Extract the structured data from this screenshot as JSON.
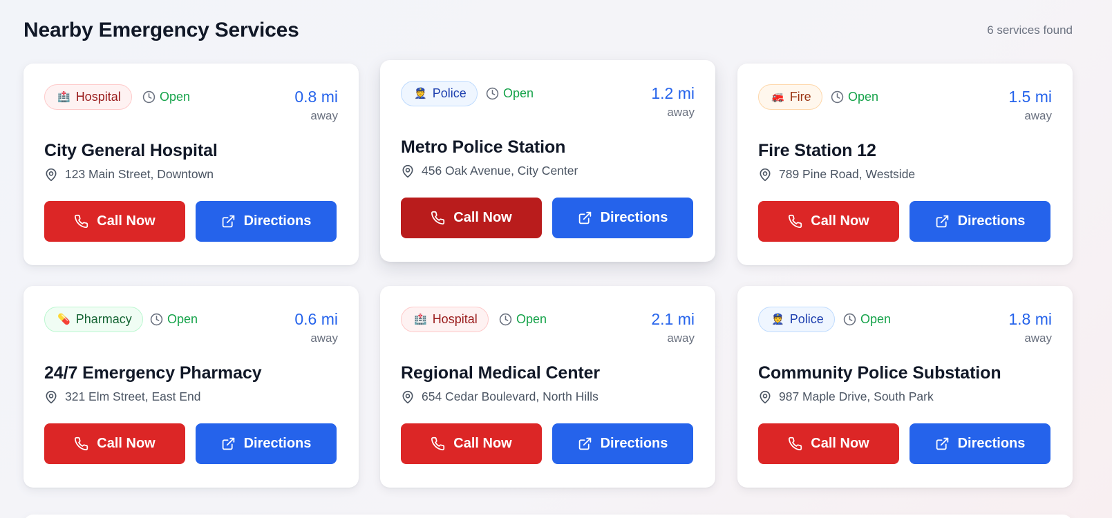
{
  "header": {
    "title": "Nearby Emergency Services",
    "count": "6 services found"
  },
  "colors": {
    "call": "#dc2626",
    "call_hover": "#b91c1c",
    "directions": "#2563eb",
    "status_open": "#16a34a",
    "distance": "#2563eb"
  },
  "cards": [
    {
      "type": "Hospital",
      "type_key": "hospital",
      "type_glyph": "🏥",
      "status": "Open",
      "distance": "0.8 mi",
      "away": "away",
      "name": "City General Hospital",
      "address": "123 Main Street, Downtown",
      "call_label": "Call Now",
      "directions_label": "Directions"
    },
    {
      "type": "Police",
      "type_key": "police",
      "type_glyph": "👮",
      "status": "Open",
      "distance": "1.2 mi",
      "away": "away",
      "name": "Metro Police Station",
      "address": "456 Oak Avenue, City Center",
      "call_label": "Call Now",
      "directions_label": "Directions"
    },
    {
      "type": "Fire",
      "type_key": "fire",
      "type_glyph": "🚒",
      "status": "Open",
      "distance": "1.5 mi",
      "away": "away",
      "name": "Fire Station 12",
      "address": "789 Pine Road, Westside",
      "call_label": "Call Now",
      "directions_label": "Directions"
    },
    {
      "type": "Pharmacy",
      "type_key": "pharmacy",
      "type_glyph": "💊",
      "status": "Open",
      "distance": "0.6 mi",
      "away": "away",
      "name": "24/7 Emergency Pharmacy",
      "address": "321 Elm Street, East End",
      "call_label": "Call Now",
      "directions_label": "Directions"
    },
    {
      "type": "Hospital",
      "type_key": "hospital",
      "type_glyph": "🏥",
      "status": "Open",
      "distance": "2.1 mi",
      "away": "away",
      "name": "Regional Medical Center",
      "address": "654 Cedar Boulevard, North Hills",
      "call_label": "Call Now",
      "directions_label": "Directions"
    },
    {
      "type": "Police",
      "type_key": "police",
      "type_glyph": "👮",
      "status": "Open",
      "distance": "1.8 mi",
      "away": "away",
      "name": "Community Police Substation",
      "address": "987 Maple Drive, South Park",
      "call_label": "Call Now",
      "directions_label": "Directions"
    }
  ]
}
